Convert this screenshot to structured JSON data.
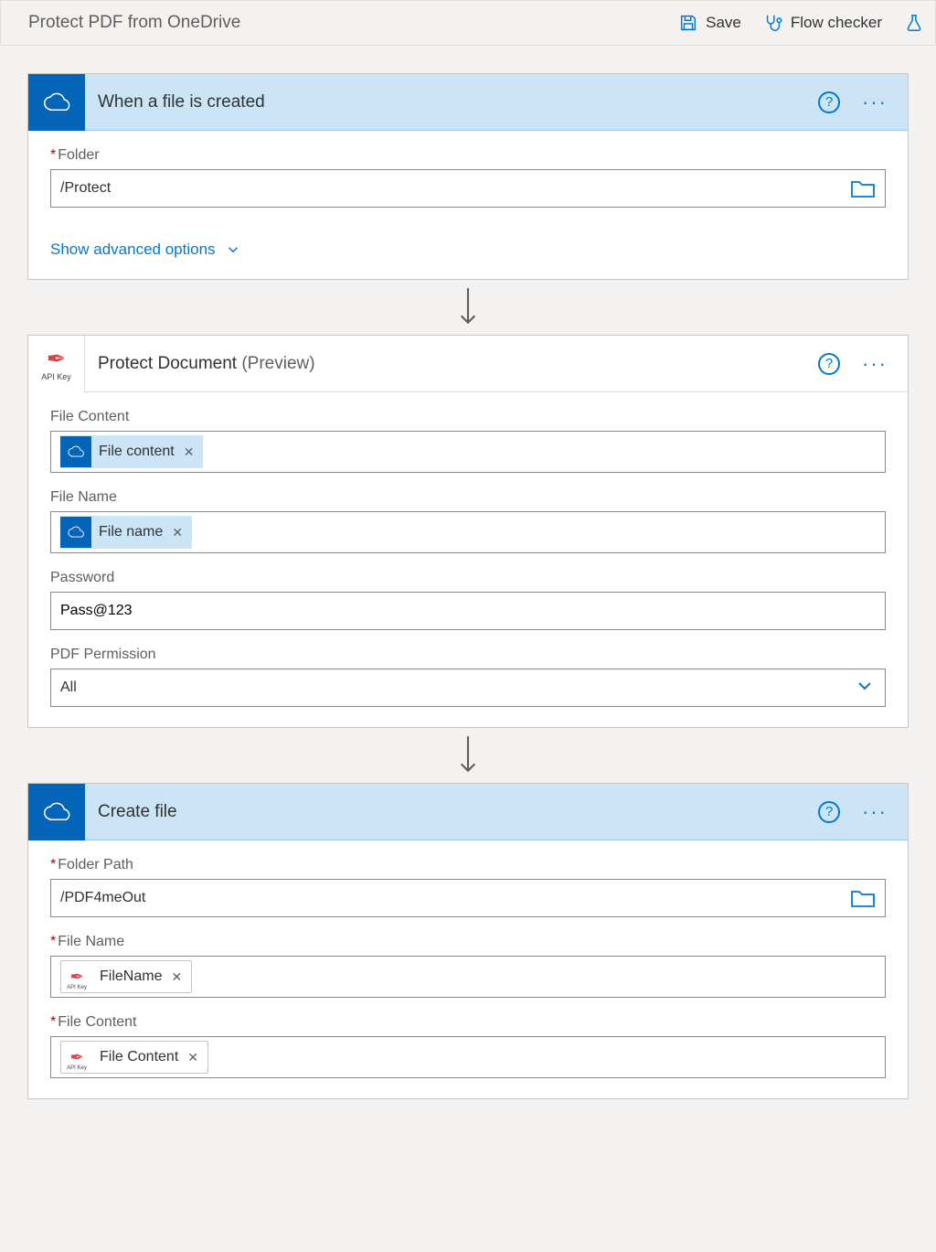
{
  "topbar": {
    "title": "Protect PDF from OneDrive",
    "save": "Save",
    "checker": "Flow checker"
  },
  "card1": {
    "title": "When a file is created",
    "folder_label": "Folder",
    "folder_value": "/Protect",
    "adv_link": "Show advanced options"
  },
  "card2": {
    "title": "Protect Document",
    "preview": "(Preview)",
    "fc_label": "File Content",
    "fc_token": "File content",
    "fn_label": "File Name",
    "fn_token": "File name",
    "pw_label": "Password",
    "pw_value": "Pass@123",
    "perm_label": "PDF Permission",
    "perm_value": "All"
  },
  "card3": {
    "title": "Create file",
    "fp_label": "Folder Path",
    "fp_value": "/PDF4meOut",
    "fn_label": "File Name",
    "fn_token": "FileName",
    "fc_label": "File Content",
    "fc_token": "File Content"
  }
}
